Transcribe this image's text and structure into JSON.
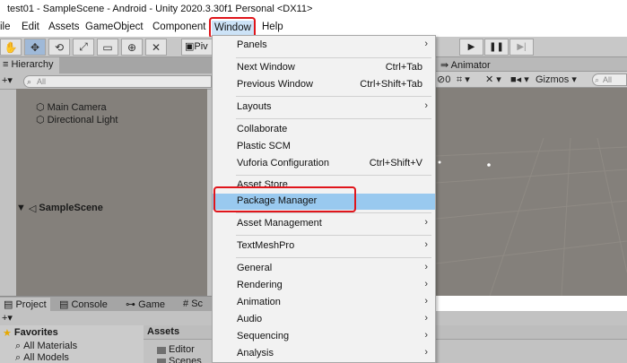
{
  "window_title": "test01 - SampleScene - Android - Unity 2020.3.30f1 Personal <DX11>",
  "menubar": {
    "items": [
      "ile",
      "Edit",
      "Assets",
      "GameObject",
      "Component",
      "Window",
      "Help"
    ]
  },
  "toolbar": {
    "tools": [
      "hand-icon",
      "move-icon",
      "rotate-icon",
      "scale-icon",
      "rect-icon",
      "transform-icon",
      "custom-tool-icon"
    ],
    "pivot_label": "Piv",
    "play_buttons": [
      "play-icon",
      "pause-icon",
      "step-icon"
    ]
  },
  "hierarchy": {
    "tab_label": "Hierarchy",
    "search_placeholder": "All",
    "scene_name": "SampleScene",
    "objects": [
      "Main Camera",
      "Directional Light"
    ]
  },
  "scene_view": {
    "tab_label": "Animator",
    "count": "0",
    "gizmos_label": "Gizmos",
    "search_placeholder": "All"
  },
  "project": {
    "tabs": [
      "Project",
      "Console",
      "Game",
      "Sc"
    ],
    "favorites_title": "Favorites",
    "favorites": [
      "All Materials",
      "All Models"
    ],
    "assets_title": "Assets",
    "folders": [
      "Editor",
      "Scenes"
    ]
  },
  "window_menu": {
    "items": [
      {
        "label": "Panels",
        "shortcut": "",
        "submenu": true
      },
      {
        "label": "Next Window",
        "shortcut": "Ctrl+Tab",
        "submenu": false
      },
      {
        "label": "Previous Window",
        "shortcut": "Ctrl+Shift+Tab",
        "submenu": false
      },
      {
        "label": "Layouts",
        "shortcut": "",
        "submenu": true
      },
      {
        "label": "Collaborate",
        "shortcut": "",
        "submenu": false
      },
      {
        "label": "Plastic SCM",
        "shortcut": "",
        "submenu": false
      },
      {
        "label": "Vuforia Configuration",
        "shortcut": "Ctrl+Shift+V",
        "submenu": false
      },
      {
        "label": "Asset Store",
        "shortcut": "",
        "submenu": false
      },
      {
        "label": "Package Manager",
        "shortcut": "",
        "submenu": false
      },
      {
        "label": "Asset Management",
        "shortcut": "",
        "submenu": true
      },
      {
        "label": "TextMeshPro",
        "shortcut": "",
        "submenu": true
      },
      {
        "label": "General",
        "shortcut": "",
        "submenu": true
      },
      {
        "label": "Rendering",
        "shortcut": "",
        "submenu": true
      },
      {
        "label": "Animation",
        "shortcut": "",
        "submenu": true
      },
      {
        "label": "Audio",
        "shortcut": "",
        "submenu": true
      },
      {
        "label": "Sequencing",
        "shortcut": "",
        "submenu": true
      },
      {
        "label": "Analysis",
        "shortcut": "",
        "submenu": true
      }
    ],
    "highlighted": "Package Manager"
  },
  "colors": {
    "annotation_red": "#e0151b",
    "menu_highlight": "#99c9ef",
    "scene_background": "#84807b"
  }
}
